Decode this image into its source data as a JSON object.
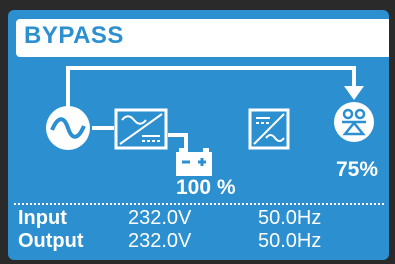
{
  "screen": {
    "title": "BYPASS",
    "battery_percent": "100 %",
    "load_percent": "75%",
    "colors": {
      "background": "#2b8fd0",
      "foreground": "#ffffff"
    },
    "icons": [
      "ac-source-icon",
      "rectifier-icon",
      "battery-icon",
      "inverter-icon",
      "load-icon",
      "arrow-down-icon"
    ],
    "readings": [
      {
        "label": "Input",
        "voltage": "232.0V",
        "frequency": "50.0Hz"
      },
      {
        "label": "Output",
        "voltage": "232.0V",
        "frequency": "50.0Hz"
      }
    ]
  }
}
